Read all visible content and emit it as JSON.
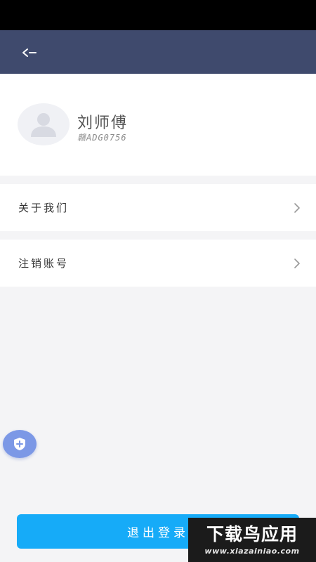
{
  "header": {
    "back_icon": "back-arrow-icon",
    "background": "#3f4a6d"
  },
  "profile": {
    "avatar_icon": "user-avatar-icon",
    "name": "刘师傅",
    "plate": "赣ADG0756"
  },
  "menu": {
    "items": [
      {
        "label": "关于我们",
        "icon": "chevron-right-icon"
      },
      {
        "label": "注销账号",
        "icon": "chevron-right-icon"
      }
    ]
  },
  "fab": {
    "icon": "shield-plus-icon",
    "color": "#7c98e6"
  },
  "logout": {
    "label": "退出登录",
    "color": "#16abf8"
  },
  "watermark": {
    "title": "下载鸟应用",
    "url": "www.xiazainiao.com"
  }
}
